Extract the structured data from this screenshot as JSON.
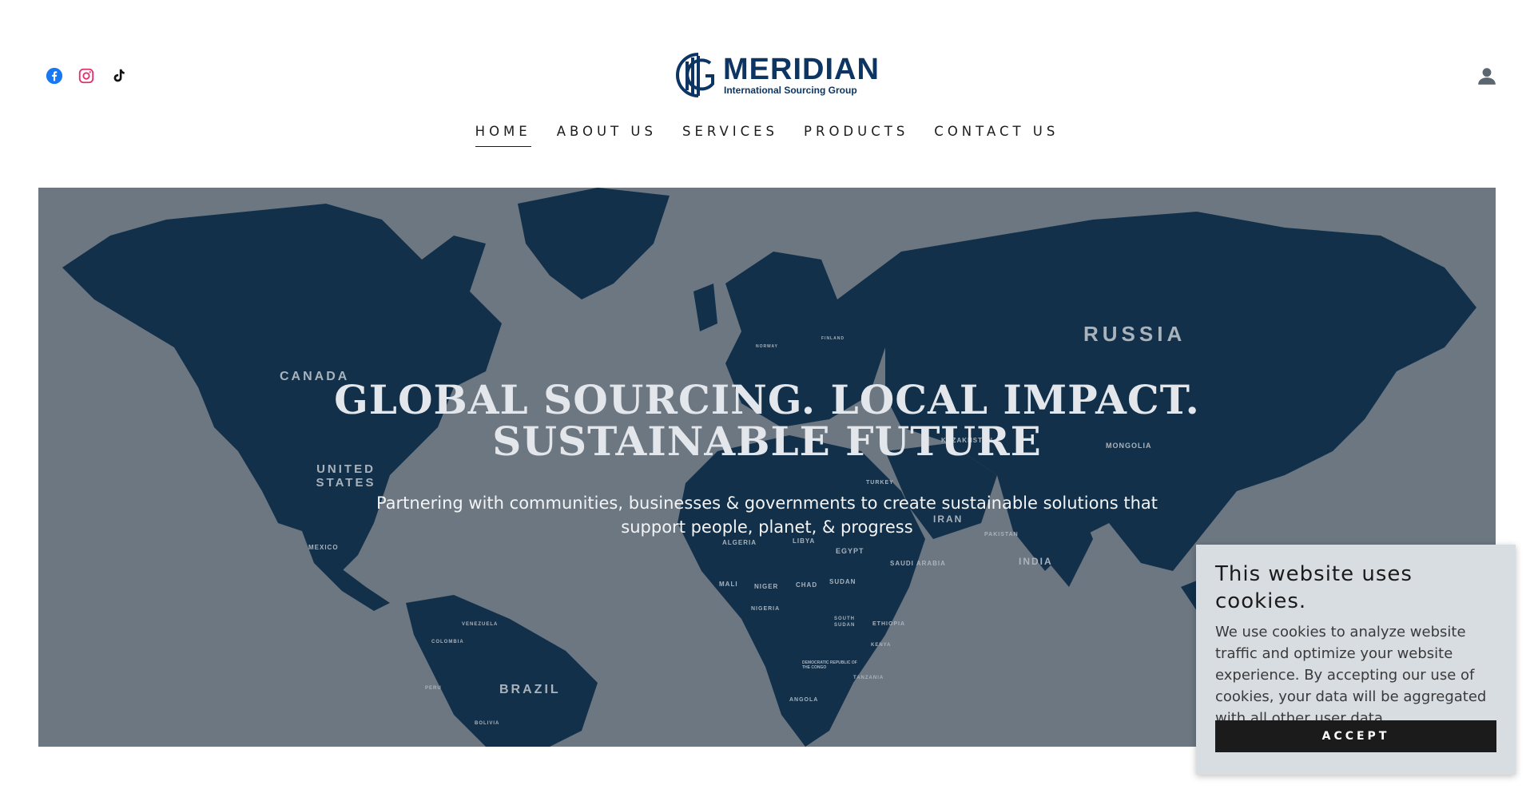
{
  "brand": {
    "name": "MERIDIAN",
    "tagline": "International Sourcing Group",
    "color": "#0c3563"
  },
  "social": [
    {
      "icon": "facebook-icon",
      "color": "#1877f2"
    },
    {
      "icon": "instagram-icon",
      "color": "#e1306c"
    },
    {
      "icon": "tiktok-icon",
      "color": "#000000"
    }
  ],
  "account": {
    "icon": "user-icon"
  },
  "nav": {
    "items": [
      {
        "label": "HOME"
      },
      {
        "label": "ABOUT US"
      },
      {
        "label": "SERVICES"
      },
      {
        "label": "PRODUCTS"
      },
      {
        "label": "CONTACT US"
      }
    ],
    "active": "HOME"
  },
  "hero": {
    "title_line1": "GLOBAL SOURCING. LOCAL IMPACT.",
    "title_line2": "SUSTAINABLE FUTURE",
    "subtitle": "Partnering with communities, businesses & governments to create sustainable solutions that support people, planet, & progress",
    "map_labels": {
      "russia": "RUSSIA",
      "canada": "CANADA",
      "united_states": "UNITED STATES",
      "brazil": "BRAZIL",
      "india": "INDIA",
      "iran": "IRAN",
      "mongolia": "MONGOLIA",
      "kazakhstan": "KAZAKHSTAN",
      "mexico": "MEXICO",
      "egypt": "EGYPT",
      "niger": "NIGER",
      "mali": "MALI",
      "sudan": "SUDAN",
      "nigeria": "NIGERIA",
      "saudi_arabia": "SAUDI ARABIA",
      "turkey": "TURKEY",
      "libya": "LIBYA",
      "chad": "CHAD",
      "ethiopia": "ETHIOPIA",
      "kenya": "KENYA",
      "angola": "ANGOLA",
      "tanzania": "TANZANIA",
      "peru": "PERU",
      "colombia": "COLOMBIA",
      "venezuela": "VENEZUELA",
      "bolivia": "BOLIVIA",
      "algeria": "ALGERIA",
      "pakistan": "PAKISTAN",
      "finland": "FINLAND",
      "norway": "NORWAY",
      "south_sudan": "SOUTH SUDAN",
      "dr_congo": "DEMOCRATIC REPUBLIC OF THE CONGO"
    },
    "colors": {
      "ocean": "#6c7782",
      "land": "#12304a",
      "label": "#a9b3bc"
    }
  },
  "cookie": {
    "title": "This website uses cookies.",
    "body": "We use cookies to analyze website traffic and optimize your website experience. By accepting our use of cookies, your data will be aggregated with all other user data.",
    "accept_label": "ACCEPT"
  }
}
